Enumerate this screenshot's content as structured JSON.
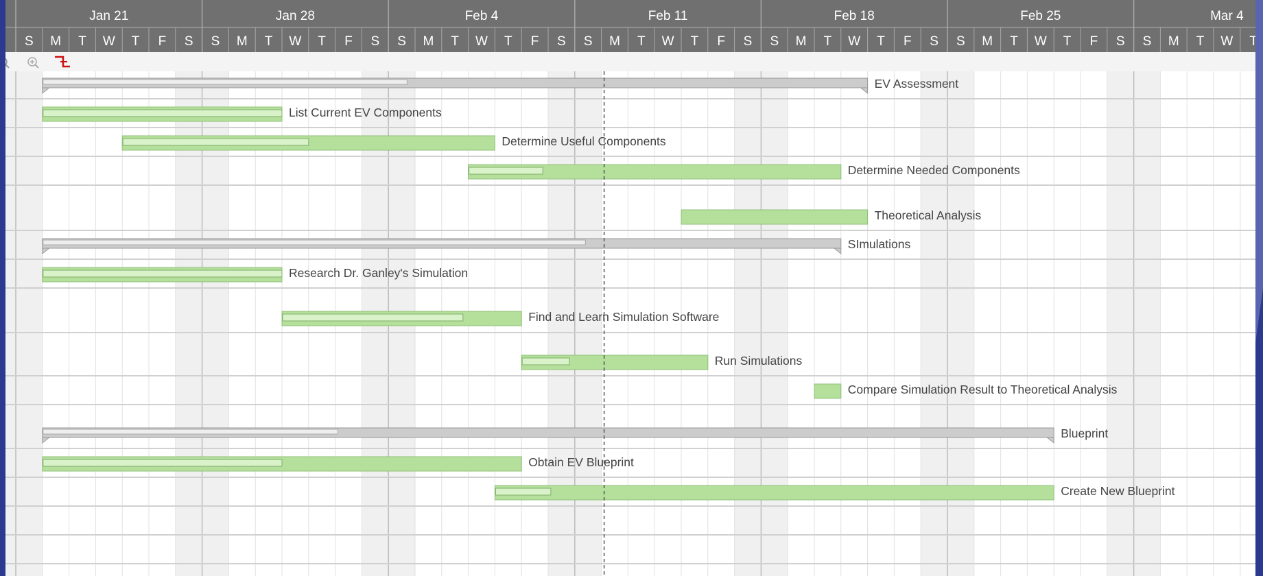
{
  "weeks": [
    {
      "label": "Jan 21"
    },
    {
      "label": "Jan 28"
    },
    {
      "label": "Feb 4"
    },
    {
      "label": "Feb 11"
    },
    {
      "label": "Feb 18"
    },
    {
      "label": "Feb 25"
    },
    {
      "label": "Mar 4"
    }
  ],
  "day_letters": [
    "S",
    "M",
    "T",
    "W",
    "T",
    "F",
    "S"
  ],
  "toolbar": {
    "icons": [
      "zoom-out-icon",
      "zoom-in-icon",
      "critical-path-icon"
    ]
  },
  "today_marker": {
    "day": 22
  },
  "tasks": [
    {
      "name": "EV Assessment",
      "type": "summary",
      "start": 1,
      "end": 32,
      "progress_end": 14.7
    },
    {
      "name": "List Current EV Components",
      "type": "task",
      "start": 1,
      "end": 10,
      "progress_end": 10
    },
    {
      "name": "Determine Useful Components",
      "type": "task",
      "start": 4,
      "end": 18,
      "progress_end": 11
    },
    {
      "name": "Determine Needed Components",
      "type": "task",
      "start": 17,
      "end": 31,
      "progress_end": 19.8
    },
    {
      "name": "Theoretical Analysis",
      "type": "task",
      "start": 25,
      "end": 32,
      "progress_end": null
    },
    {
      "name": "SImulations",
      "type": "summary",
      "start": 1,
      "end": 31,
      "progress_end": 21.4
    },
    {
      "name": "Research Dr. Ganley's Simulation",
      "type": "task",
      "start": 1,
      "end": 10,
      "progress_end": 10
    },
    {
      "name": "Find and Learn Simulation Software",
      "type": "task",
      "start": 10,
      "end": 19,
      "progress_end": 16.8
    },
    {
      "name": "Run Simulations",
      "type": "task",
      "start": 19,
      "end": 26,
      "progress_end": 20.8
    },
    {
      "name": "Compare Simulation Result to Theoretical Analysis",
      "type": "task",
      "start": 30,
      "end": 31,
      "progress_end": null
    },
    {
      "name": "Blueprint",
      "type": "summary",
      "start": 1,
      "end": 39,
      "progress_end": 12.1
    },
    {
      "name": "Obtain EV Blueprint",
      "type": "task",
      "start": 1,
      "end": 19,
      "progress_end": 10
    },
    {
      "name": "Create New Blueprint",
      "type": "task",
      "start": 18,
      "end": 39,
      "progress_end": 20.1
    }
  ],
  "colors": {
    "header_bg": "#707070",
    "task_fill": "#b5e09b",
    "task_progress": "#d9f2c9",
    "task_border": "#8fbf78",
    "summary_fill": "#cccccc",
    "summary_progress": "#eeeeee",
    "summary_border": "#999999",
    "weekend_shade": "#f0f0f0",
    "today_line": "#555555"
  }
}
